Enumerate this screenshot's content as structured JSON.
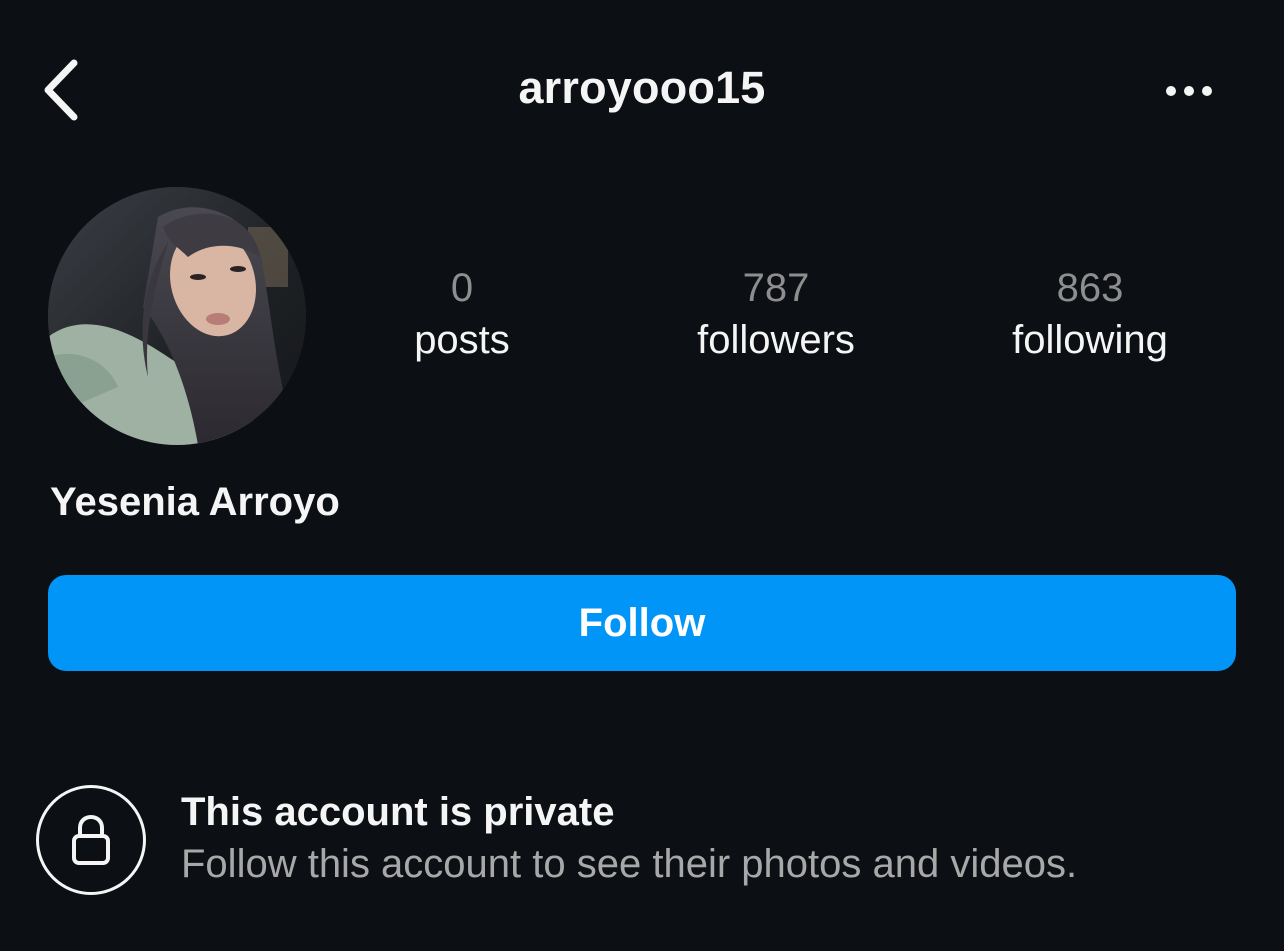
{
  "header": {
    "username": "arroyooo15",
    "back_icon": "chevron-left-icon",
    "more_icon": "more-horizontal-icon"
  },
  "profile": {
    "display_name": "Yesenia Arroyo",
    "stats": [
      {
        "count": "0",
        "label": "posts"
      },
      {
        "count": "787",
        "label": "followers"
      },
      {
        "count": "863",
        "label": "following"
      }
    ]
  },
  "actions": {
    "follow_label": "Follow",
    "follow_color": "#0095f6"
  },
  "private_notice": {
    "icon": "lock-icon",
    "title": "This account is private",
    "subtitle": "Follow this account to see their photos and videos."
  },
  "theme": {
    "background": "#0c1014",
    "text": "#f5f5f5",
    "muted": "#8e8e8e"
  }
}
